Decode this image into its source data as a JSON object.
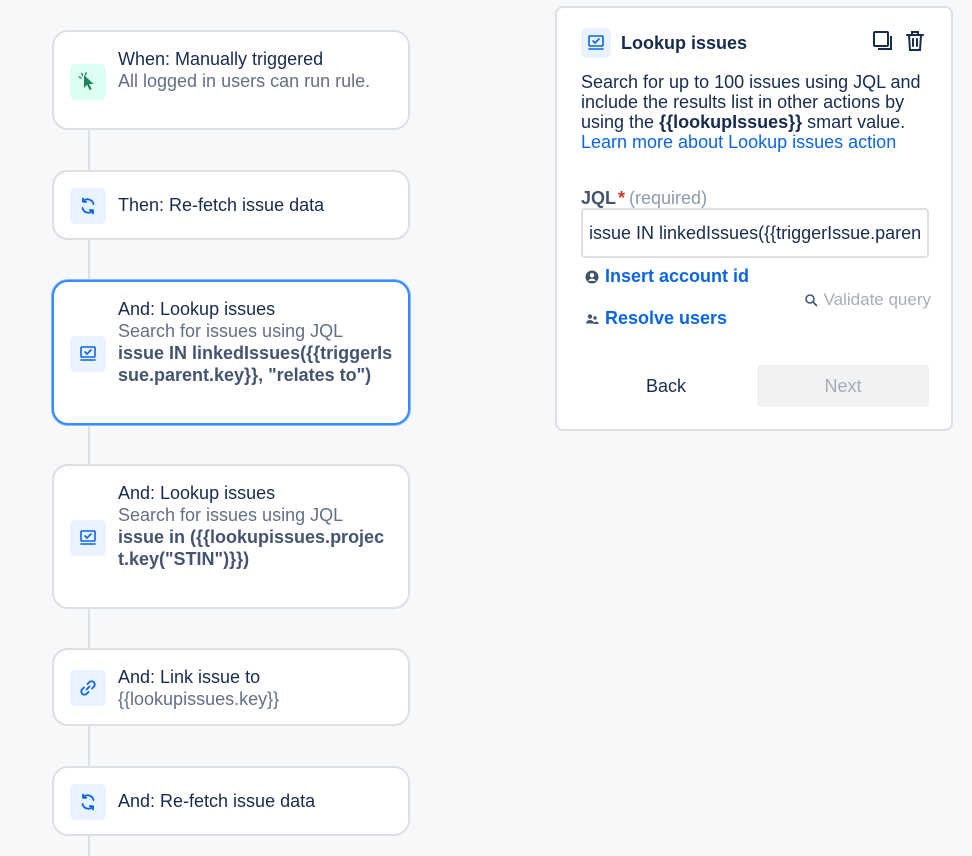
{
  "flow": {
    "cards": [
      {
        "title": "When: Manually triggered",
        "sub": "All logged in users can run rule.",
        "icon": "cursor-click-icon"
      },
      {
        "title": "Then: Re-fetch issue data",
        "icon": "refresh-icon"
      },
      {
        "title": "And: Lookup issues",
        "sub": "Search for issues using JQL",
        "bold": "issue IN linkedIssues({{triggerIssue.parent.key}}, \"relates to\")",
        "icon": "monitor-check-icon"
      },
      {
        "title": "And: Lookup issues",
        "sub": "Search for issues using JQL",
        "bold": "issue in ({{lookupissues.project.key(\"STIN\")}})",
        "icon": "monitor-check-icon"
      },
      {
        "title": "And: Link issue to",
        "sub": "{{lookupissues.key}}",
        "icon": "link-icon"
      },
      {
        "title": "And: Re-fetch issue data",
        "icon": "refresh-icon"
      }
    ]
  },
  "panel": {
    "title": "Lookup issues",
    "desc_prefix": "Search for up to 100 issues using JQL and include the results list in other actions by using the ",
    "desc_smart": "{{lookupIssues}}",
    "desc_mid": " smart value. ",
    "desc_link": "Learn more about Lookup issues action",
    "jql_label": "JQL",
    "jql_star": "*",
    "jql_required": "(required)",
    "jql_value": "issue IN linkedIssues({{triggerIssue.parent.key}}, \"relates to\")",
    "insert_account": "Insert account id",
    "resolve_users": "Resolve users",
    "validate": "Validate query",
    "back": "Back",
    "next": "Next"
  },
  "colors": {
    "selected_border": "#388bff",
    "link": "#0c66e4",
    "required_star": "#c9372c"
  }
}
